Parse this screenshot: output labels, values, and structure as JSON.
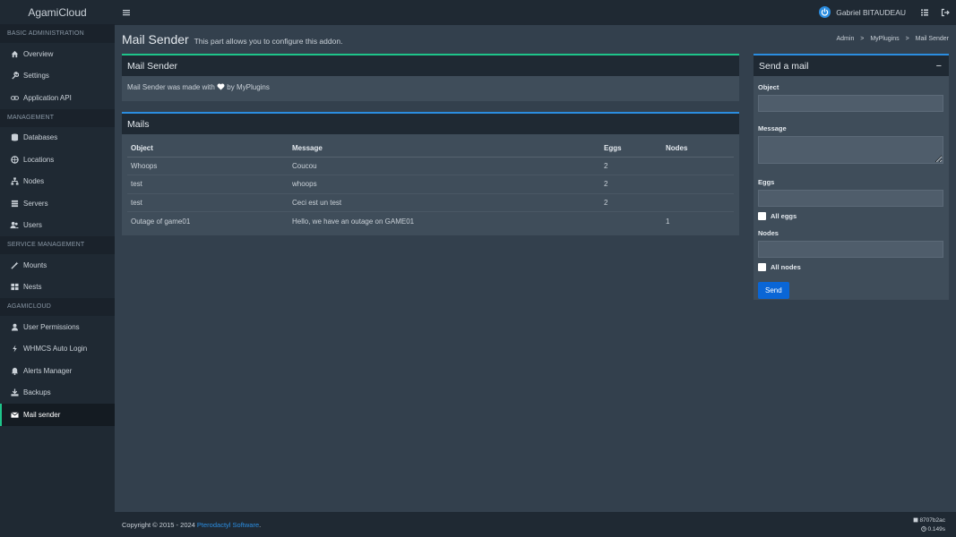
{
  "brand": "AgamiCloud",
  "sidebar": {
    "sections": [
      {
        "header": "BASIC ADMINISTRATION",
        "items": [
          {
            "label": "Overview",
            "icon": "home-icon"
          },
          {
            "label": "Settings",
            "icon": "wrench-icon"
          },
          {
            "label": "Application API",
            "icon": "link-icon"
          }
        ]
      },
      {
        "header": "MANAGEMENT",
        "items": [
          {
            "label": "Databases",
            "icon": "database-icon"
          },
          {
            "label": "Locations",
            "icon": "globe-icon"
          },
          {
            "label": "Nodes",
            "icon": "sitemap-icon"
          },
          {
            "label": "Servers",
            "icon": "server-icon"
          },
          {
            "label": "Users",
            "icon": "users-icon"
          }
        ]
      },
      {
        "header": "SERVICE MANAGEMENT",
        "items": [
          {
            "label": "Mounts",
            "icon": "magic-icon"
          },
          {
            "label": "Nests",
            "icon": "grid-icon"
          }
        ]
      },
      {
        "header": "AGAMICLOUD",
        "items": [
          {
            "label": "User Permissions",
            "icon": "user-icon"
          },
          {
            "label": "WHMCS Auto Login",
            "icon": "bolt-icon"
          },
          {
            "label": "Alerts Manager",
            "icon": "bell-icon"
          },
          {
            "label": "Backups",
            "icon": "download-icon"
          },
          {
            "label": "Mail sender",
            "icon": "envelope-icon",
            "active": true
          }
        ]
      }
    ]
  },
  "topbar": {
    "user": "Gabriel BITAUDEAU"
  },
  "page": {
    "title": "Mail Sender",
    "subtitle": "This part allows you to configure this addon."
  },
  "breadcrumb": {
    "a": "Admin",
    "b": "MyPlugins",
    "c": "Mail Sender",
    "sep": ">"
  },
  "intro": {
    "title": "Mail Sender",
    "text_before": "Mail Sender was made with",
    "text_after": "by MyPlugins"
  },
  "mails": {
    "title": "Mails",
    "columns": [
      "Object",
      "Message",
      "Eggs",
      "Nodes"
    ],
    "rows": [
      [
        "Whoops",
        "Coucou",
        "2",
        ""
      ],
      [
        "test",
        "whoops",
        "2",
        ""
      ],
      [
        "test",
        "Ceci est un test",
        "2",
        ""
      ],
      [
        "Outage of game01",
        "Hello, we have an outage on GAME01",
        "",
        "1"
      ]
    ]
  },
  "send": {
    "title": "Send a mail",
    "collapse": "−",
    "object_label": "Object",
    "message_label": "Message",
    "eggs_label": "Eggs",
    "all_eggs": "All eggs",
    "nodes_label": "Nodes",
    "all_nodes": "All nodes",
    "button": "Send"
  },
  "footer": {
    "copy": "Copyright © 2015 - 2024",
    "link": "Pterodactyl Software",
    "dot": ".",
    "version": "8707b2ac",
    "time": "0.149s"
  },
  "colors": {
    "accent_green": "#1ec48a",
    "accent_blue": "#2b8de0",
    "button": "#0a66d6"
  }
}
